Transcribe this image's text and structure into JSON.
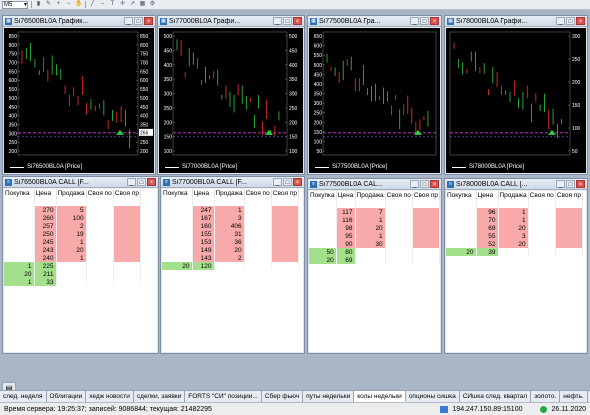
{
  "toolbar": {
    "interval_select": "M5",
    "icons": [
      "bar-chart-icon",
      "pencil-icon",
      "zoom-in-icon",
      "zoom-out-icon",
      "hand-icon",
      "line-tool-icon",
      "dash-icon",
      "text-icon",
      "crosshair-icon",
      "arrow-icon",
      "grid-icon",
      "settings-icon"
    ]
  },
  "charts": [
    {
      "title": "Si76500BL0A График...",
      "legend": "Si76500BL0A [Price]",
      "y_left_ticks": [
        "850",
        "800",
        "750",
        "700",
        "650",
        "600",
        "550",
        "500",
        "450",
        "400",
        "350",
        "300",
        "250",
        "200"
      ],
      "y_right_ticks": [
        "850",
        "800",
        "750",
        "700",
        "650",
        "600",
        "550",
        "500",
        "450",
        "400",
        "350",
        "300",
        "250",
        "200"
      ],
      "price_marker": "266",
      "colors": {
        "candle_up": "#2ecc40",
        "candle_down": "#ff3030",
        "level_line": "#ff40ff",
        "level_line2": "#8080ff"
      }
    },
    {
      "title": "Si77000BL0A Графи...",
      "legend": "Si77000BL0A [Price]",
      "y_left_ticks": [
        "500",
        "450",
        "400",
        "350",
        "300",
        "250",
        "200",
        "150",
        "100"
      ],
      "y_right_ticks": [
        "500",
        "450",
        "400",
        "350",
        "300",
        "250",
        "200",
        "150",
        "100"
      ],
      "price_marker": "",
      "colors": {
        "candle_up": "#2ecc40",
        "candle_down": "#ff3030",
        "level_line": "#ff40ff",
        "level_line2": "#8080ff"
      }
    },
    {
      "title": "Si77500BL0A Гра...",
      "legend": "Si77500BL0A [Price]",
      "y_left_ticks": [
        "650",
        "600",
        "550",
        "500",
        "450",
        "400",
        "350",
        "300",
        "250",
        "200",
        "150",
        "100",
        "50"
      ],
      "y_right_ticks": [],
      "price_marker": "",
      "colors": {
        "candle_up": "#2ecc40",
        "candle_down": "#ff3030",
        "level_line": "#ff40ff",
        "level_line2": "#8080ff"
      }
    },
    {
      "title": "Si78000BL0A Графи...",
      "legend": "Si78000BL0A [Price]",
      "y_left_ticks": [],
      "y_right_ticks": [
        "300",
        "250",
        "200",
        "150",
        "100",
        "50"
      ],
      "price_marker": "",
      "colors": {
        "candle_up": "#2ecc40",
        "candle_down": "#ff3030",
        "level_line": "#ff40ff",
        "level_line2": "#8080ff"
      }
    }
  ],
  "order_books": [
    {
      "title": "Si76500BL0A CALL [F...",
      "columns": [
        "Покупка",
        "Цена",
        "Продажа",
        "Своя по",
        "Своя пр"
      ],
      "rows": [
        {
          "buy": "",
          "price": "270",
          "sell": "5",
          "type": "ask"
        },
        {
          "buy": "",
          "price": "260",
          "sell": "100",
          "type": "ask"
        },
        {
          "buy": "",
          "price": "257",
          "sell": "2",
          "type": "ask"
        },
        {
          "buy": "",
          "price": "250",
          "sell": "19",
          "type": "ask"
        },
        {
          "buy": "",
          "price": "245",
          "sell": "1",
          "type": "ask"
        },
        {
          "buy": "",
          "price": "243",
          "sell": "20",
          "type": "ask"
        },
        {
          "buy": "",
          "price": "240",
          "sell": "1",
          "type": "ask"
        },
        {
          "buy": "1",
          "price": "225",
          "sell": "",
          "type": "bid"
        },
        {
          "buy": "20",
          "price": "211",
          "sell": "",
          "type": "bid"
        },
        {
          "buy": "1",
          "price": "33",
          "sell": "",
          "type": "bid"
        }
      ]
    },
    {
      "title": "Si77000BL0A CALL [F...",
      "columns": [
        "Покупка",
        "Цена",
        "Продажа",
        "Своя по",
        "Своя пр"
      ],
      "rows": [
        {
          "buy": "",
          "price": "247",
          "sell": "1",
          "type": "ask"
        },
        {
          "buy": "",
          "price": "167",
          "sell": "3",
          "type": "ask"
        },
        {
          "buy": "",
          "price": "160",
          "sell": "406",
          "type": "ask"
        },
        {
          "buy": "",
          "price": "155",
          "sell": "31",
          "type": "ask"
        },
        {
          "buy": "",
          "price": "153",
          "sell": "36",
          "type": "ask"
        },
        {
          "buy": "",
          "price": "149",
          "sell": "20",
          "type": "ask"
        },
        {
          "buy": "",
          "price": "143",
          "sell": "2",
          "type": "ask"
        },
        {
          "buy": "20",
          "price": "120",
          "sell": "",
          "type": "bid"
        }
      ]
    },
    {
      "title": "Si77500BL0A CAL...",
      "columns": [
        "Покупка",
        "Цена",
        "Продажа",
        "Своя по",
        "Своя пр"
      ],
      "rows": [
        {
          "buy": "",
          "price": "117",
          "sell": "7",
          "type": "ask"
        },
        {
          "buy": "",
          "price": "116",
          "sell": "1",
          "type": "ask"
        },
        {
          "buy": "",
          "price": "98",
          "sell": "20",
          "type": "ask"
        },
        {
          "buy": "",
          "price": "95",
          "sell": "1",
          "type": "ask"
        },
        {
          "buy": "",
          "price": "90",
          "sell": "30",
          "type": "ask"
        },
        {
          "buy": "50",
          "price": "80",
          "sell": "",
          "type": "bid"
        },
        {
          "buy": "20",
          "price": "69",
          "sell": "",
          "type": "bid"
        }
      ]
    },
    {
      "title": "Si78000BL0A CALL [...",
      "columns": [
        "Покупка",
        "Цена",
        "Продажа",
        "Своя по",
        "Своя пр"
      ],
      "rows": [
        {
          "buy": "",
          "price": "96",
          "sell": "1",
          "type": "ask"
        },
        {
          "buy": "",
          "price": "70",
          "sell": "1",
          "type": "ask"
        },
        {
          "buy": "",
          "price": "69",
          "sell": "20",
          "type": "ask"
        },
        {
          "buy": "",
          "price": "55",
          "sell": "3",
          "type": "ask"
        },
        {
          "buy": "",
          "price": "52",
          "sell": "20",
          "type": "ask"
        },
        {
          "buy": "20",
          "price": "39",
          "sell": "",
          "type": "bid"
        }
      ]
    }
  ],
  "tabs": [
    {
      "label": "след. неделя",
      "active": false
    },
    {
      "label": "Облигации",
      "active": false
    },
    {
      "label": "хедж новости",
      "active": false
    },
    {
      "label": "сделки, заявки",
      "active": false
    },
    {
      "label": "FORTS \"СИ\" позиции...",
      "active": false
    },
    {
      "label": "Сбер фьюч",
      "active": false
    },
    {
      "label": "путы недельки",
      "active": false
    },
    {
      "label": "колы недельки",
      "active": true
    },
    {
      "label": "опционы сишка",
      "active": false
    },
    {
      "label": "СИшка след. квартал",
      "active": false
    },
    {
      "label": "золото.",
      "active": false
    },
    {
      "label": "нефть.",
      "active": false
    },
    {
      "label": "опционы ртс",
      "active": false
    }
  ],
  "status": {
    "server_time": "Время сервера: 19:25:37; записей: 9086844; текущая: 21482295",
    "ip": "194.247.150.89:15100",
    "date": "26.11.2020"
  }
}
